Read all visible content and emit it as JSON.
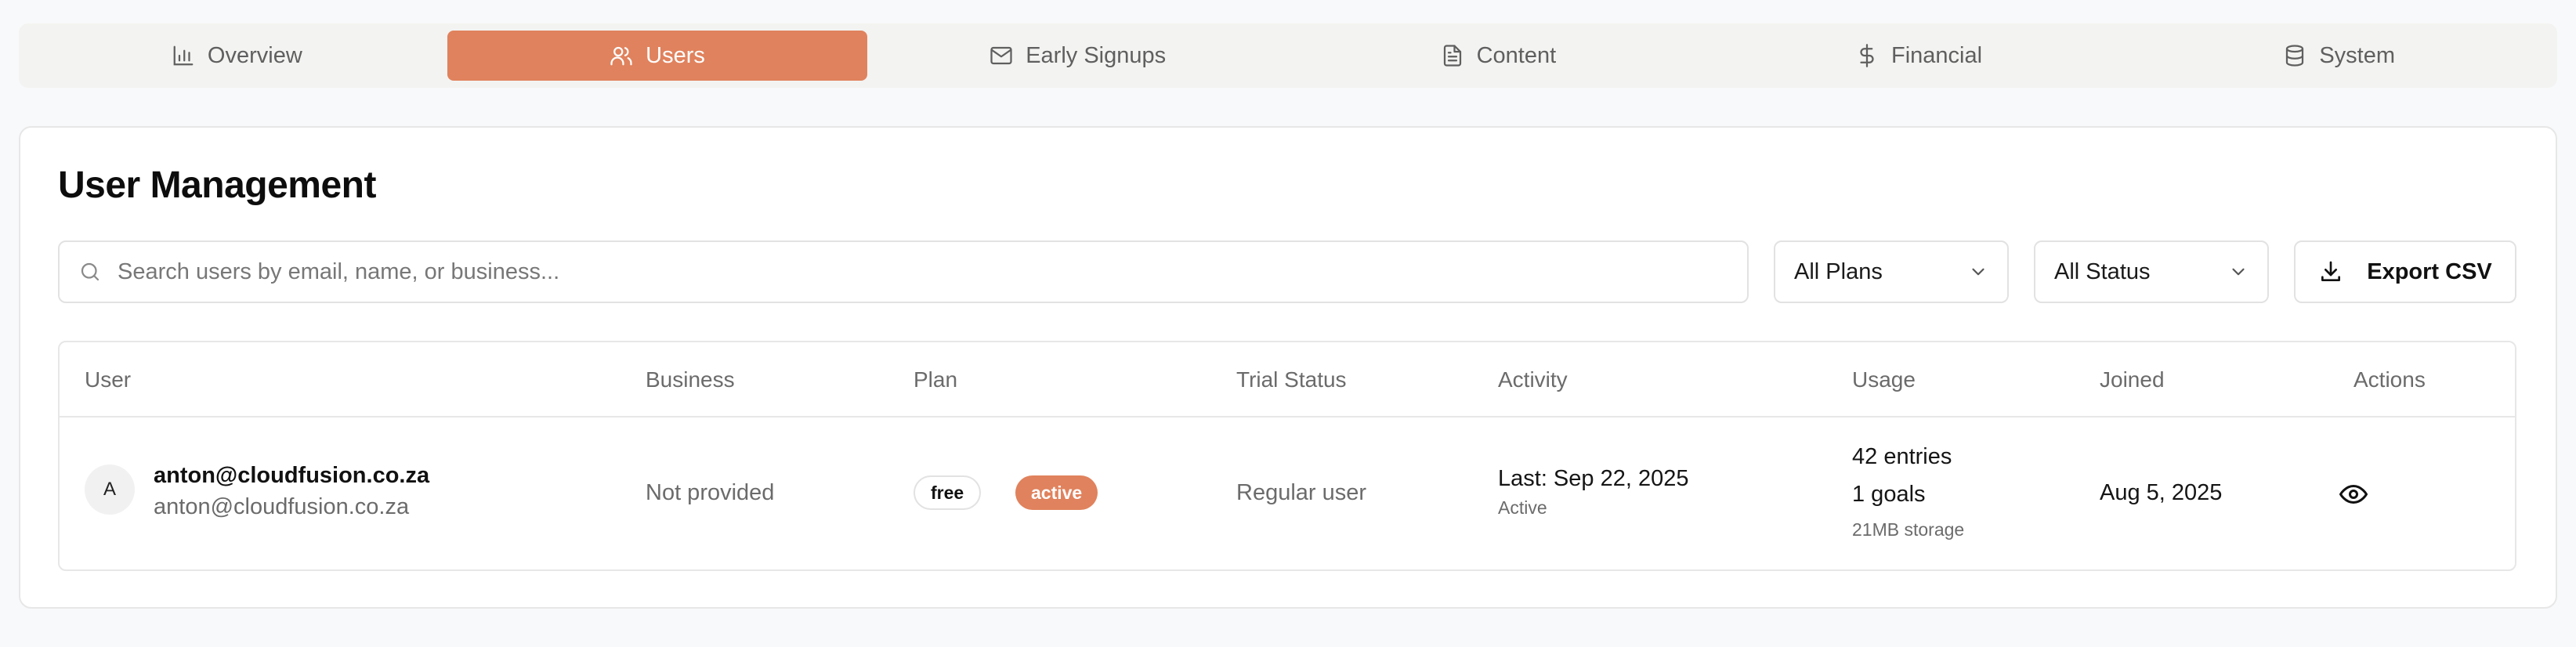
{
  "tabs": [
    {
      "label": "Overview",
      "icon": "bar-chart-icon",
      "active": false
    },
    {
      "label": "Users",
      "icon": "users-icon",
      "active": true
    },
    {
      "label": "Early Signups",
      "icon": "mail-icon",
      "active": false
    },
    {
      "label": "Content",
      "icon": "file-text-icon",
      "active": false
    },
    {
      "label": "Financial",
      "icon": "dollar-icon",
      "active": false
    },
    {
      "label": "System",
      "icon": "database-icon",
      "active": false
    }
  ],
  "page": {
    "title": "User Management"
  },
  "toolbar": {
    "search_placeholder": "Search users by email, name, or business...",
    "plan_filter": "All Plans",
    "status_filter": "All Status",
    "export_label": "Export CSV"
  },
  "table": {
    "columns": [
      "User",
      "Business",
      "Plan",
      "Trial Status",
      "Activity",
      "Usage",
      "Joined",
      "Actions"
    ],
    "rows": [
      {
        "avatar_initial": "A",
        "user_primary": "anton@cloudfusion.co.za",
        "user_secondary": "anton@cloudfusion.co.za",
        "business": "Not provided",
        "plan": "free",
        "status": "active",
        "trial_status": "Regular user",
        "activity_last": "Last: Sep 22, 2025",
        "activity_state": "Active",
        "usage_entries": "42 entries",
        "usage_goals": "1 goals",
        "usage_storage": "21MB storage",
        "joined": "Aug 5, 2025"
      }
    ]
  },
  "colors": {
    "accent": "#e0825d",
    "tabbar_bg": "#f3f3f1",
    "page_bg": "#f8f9fa",
    "border": "#e7e7e7"
  }
}
